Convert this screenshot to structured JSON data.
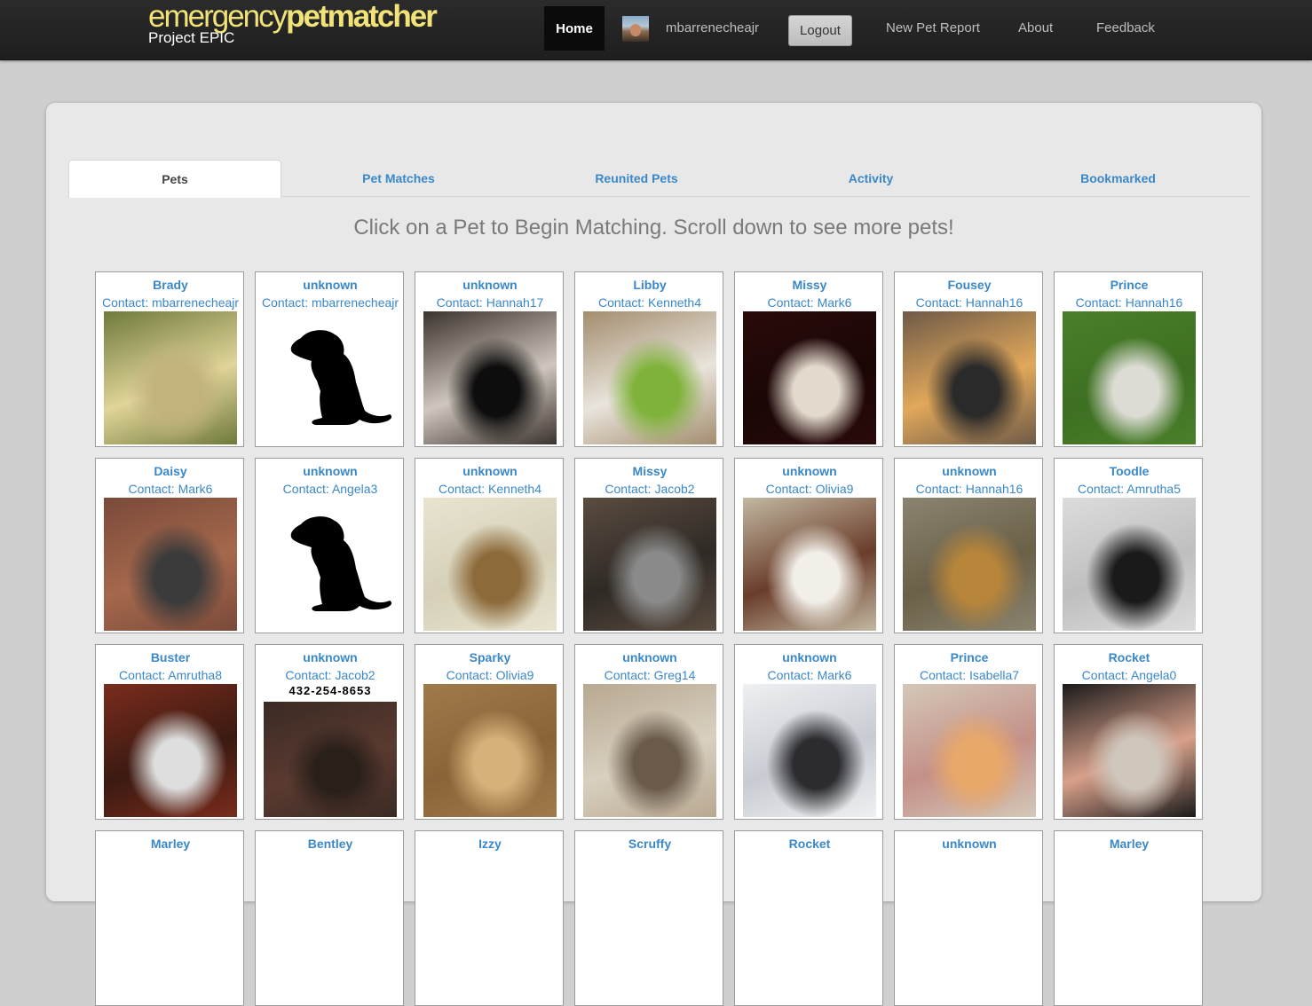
{
  "navbar": {
    "brand_part1": "emergency",
    "brand_part2": "petmatcher",
    "brand_sub": "Project EPIC",
    "home": "Home",
    "username": "mbarrenecheajr",
    "logout": "Logout",
    "new_report": "New Pet Report",
    "about": "About",
    "feedback": "Feedback"
  },
  "tabs": [
    {
      "label": "Pets",
      "active": true
    },
    {
      "label": "Pet Matches"
    },
    {
      "label": "Reunited Pets"
    },
    {
      "label": "Activity"
    },
    {
      "label": "Bookmarked"
    }
  ],
  "headline": "Click on a Pet to Begin Matching. Scroll down to see more pets!",
  "contact_prefix": "Contact: ",
  "pets": [
    {
      "name": "Brady",
      "contact": "mbarrenecheajr",
      "photo": "yellow dog in flowers",
      "colors": [
        "#6f7a3a",
        "#c2b27b",
        "#e0d49a"
      ]
    },
    {
      "name": "unknown",
      "contact": "mbarrenecheajr",
      "photo": "dog silhouette",
      "silhouette": true
    },
    {
      "name": "unknown",
      "contact": "Hannah17",
      "photo": "black cat",
      "colors": [
        "#3a322c",
        "#0e0d0d",
        "#cfc7bd"
      ]
    },
    {
      "name": "Libby",
      "contact": "Kenneth4",
      "photo": "green parrot",
      "colors": [
        "#a38d6e",
        "#7fb23a",
        "#e9e4dc"
      ]
    },
    {
      "name": "Missy",
      "contact": "Mark6",
      "photo": "shiba dog poster",
      "colors": [
        "#2a0a0a",
        "#e3d9cc",
        "#1a0606"
      ]
    },
    {
      "name": "Fousey",
      "contact": "Hannah16",
      "photo": "black dog on blanket",
      "colors": [
        "#6e5a48",
        "#2a2a2a",
        "#e1a85a"
      ]
    },
    {
      "name": "Prince",
      "contact": "Hannah16",
      "photo": "white bulldog on grass",
      "colors": [
        "#4a7f2a",
        "#dcdcd4",
        "#3e6f22"
      ]
    },
    {
      "name": "Daisy",
      "contact": "Mark6",
      "photo": "grey cat on floor",
      "colors": [
        "#7a4a3a",
        "#3b3b3b",
        "#a5684c"
      ]
    },
    {
      "name": "unknown",
      "contact": "Angela3",
      "photo": "dog silhouette",
      "silhouette": true
    },
    {
      "name": "unknown",
      "contact": "Kenneth4",
      "photo": "yorkie on couch",
      "colors": [
        "#e8e4d0",
        "#8c6a3a",
        "#d6d0b8"
      ]
    },
    {
      "name": "Missy",
      "contact": "Jacob2",
      "photo": "grey and white cat",
      "colors": [
        "#5a4c40",
        "#8a8a8a",
        "#2f2a25"
      ]
    },
    {
      "name": "unknown",
      "contact": "Olivia9",
      "photo": "terrier in room",
      "colors": [
        "#c2b8a2",
        "#f2efe9",
        "#6a3d2a"
      ]
    },
    {
      "name": "unknown",
      "contact": "Hannah16",
      "photo": "dog behind fence",
      "colors": [
        "#8a8470",
        "#b8863a",
        "#6b6048"
      ]
    },
    {
      "name": "Toodle",
      "contact": "Amrutha5",
      "photo": "black puppy blurred",
      "colors": [
        "#dcdcdc",
        "#1a1a1a",
        "#bfbfbf"
      ]
    },
    {
      "name": "Buster",
      "contact": "Amrutha8",
      "photo": "cat lying on floor",
      "colors": [
        "#7a2c1c",
        "#dedede",
        "#3b1a12"
      ]
    },
    {
      "name": "unknown",
      "contact": "Jacob2",
      "photo": "reward poster",
      "poster": true,
      "poster_phone": "432-254-8653",
      "colors": [
        "#3a2a24",
        "#2a201a",
        "#5a3a30"
      ]
    },
    {
      "name": "Sparky",
      "contact": "Olivia9",
      "photo": "kitten in box",
      "colors": [
        "#a07a4a",
        "#d8b07a",
        "#8a6438"
      ]
    },
    {
      "name": "unknown",
      "contact": "Greg14",
      "photo": "fluffy grey cat",
      "colors": [
        "#b8a890",
        "#6a5a4a",
        "#d8d0c0"
      ]
    },
    {
      "name": "unknown",
      "contact": "Mark6",
      "photo": "dog on tile floor",
      "colors": [
        "#eef0f2",
        "#2c2c30",
        "#c8ccd2"
      ]
    },
    {
      "name": "Prince",
      "contact": "Isabella7",
      "photo": "orange cat in bed",
      "colors": [
        "#d4c8b8",
        "#e8a86a",
        "#c49088"
      ]
    },
    {
      "name": "Rocket",
      "contact": "Angela0",
      "photo": "chihuahua in blanket",
      "colors": [
        "#1a1a1a",
        "#cfc6bc",
        "#d8a08a"
      ]
    },
    {
      "name": "Marley"
    },
    {
      "name": "Bentley"
    },
    {
      "name": "Izzy"
    },
    {
      "name": "Scruffy"
    },
    {
      "name": "Rocket"
    },
    {
      "name": "unknown"
    },
    {
      "name": "Marley"
    }
  ]
}
